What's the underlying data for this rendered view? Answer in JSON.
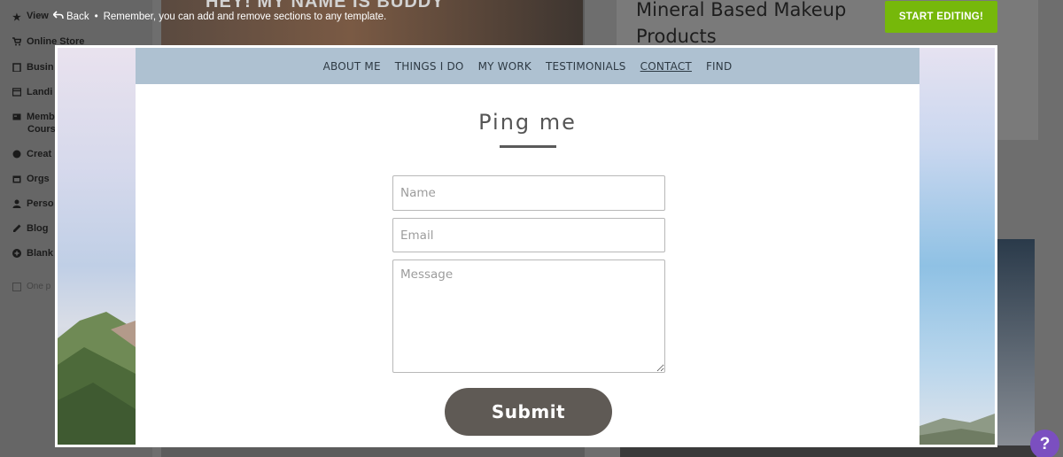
{
  "topbar": {
    "view_label": "View",
    "back_label": "Back",
    "separator": "•",
    "hint": "Remember, you can add and remove sections to any template."
  },
  "sidebar": {
    "items": [
      {
        "label": "View",
        "icon": "star-icon"
      },
      {
        "label": "Online Store",
        "icon": "cart-icon"
      },
      {
        "label": "Busin",
        "icon": "clipboard-icon"
      },
      {
        "label": "Landi",
        "icon": "window-icon"
      },
      {
        "label": "Memb",
        "icon": "card-icon"
      },
      {
        "label": "Cours",
        "icon": ""
      },
      {
        "label": "Creat",
        "icon": "palette-icon"
      },
      {
        "label": "Orgs",
        "icon": "calendar-icon"
      },
      {
        "label": "Perso",
        "icon": "user-icon"
      },
      {
        "label": "Blog",
        "icon": "pen-icon"
      },
      {
        "label": "Blank",
        "icon": "plus-circle-icon"
      },
      {
        "label": "One p",
        "icon": "checkbox-icon"
      }
    ]
  },
  "background": {
    "dog_caption": "HEY! MY NAME IS BUDDY",
    "right_card_title": "Mineral Based Makeup Products"
  },
  "start_button": "START EDITING!",
  "preview": {
    "nav": [
      "ABOUT ME",
      "THINGS I DO",
      "MY WORK",
      "TESTIMONIALS",
      "CONTACT",
      "FIND"
    ],
    "active_nav": "CONTACT",
    "heading": "Ping me",
    "form": {
      "name_placeholder": "Name",
      "email_placeholder": "Email",
      "message_placeholder": "Message",
      "submit_label": "Submit"
    }
  },
  "help_label": "?",
  "colors": {
    "start_button": "#76b80a",
    "nav_bar": "#aec1d1",
    "submit_button": "#5f5a55",
    "help_button": "#7b4fc0"
  }
}
